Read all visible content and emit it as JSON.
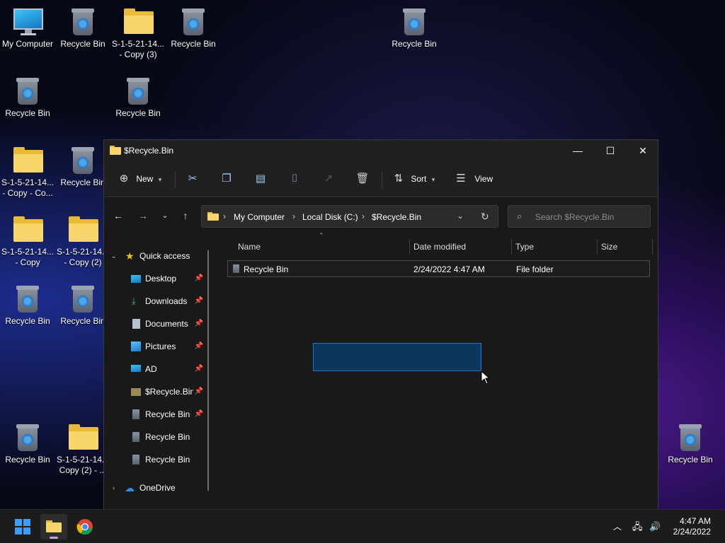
{
  "desktop": {
    "icons": [
      {
        "label": "My Computer",
        "kind": "monitor"
      },
      {
        "label": "Recycle Bin",
        "kind": "bin"
      },
      {
        "label1": "S-1-5-21-14...",
        "label2": "- Copy (3)",
        "kind": "folder"
      },
      {
        "label": "Recycle Bin",
        "kind": "bin"
      },
      {
        "label": "Recycle Bin",
        "kind": "bin"
      },
      {
        "label": "Recycle Bin",
        "kind": "bin"
      },
      {
        "label": "Recycle Bin",
        "kind": "bin"
      },
      {
        "label1": "S-1-5-21-14...",
        "label2": "- Copy - Co...",
        "kind": "folder"
      },
      {
        "label": "Recycle Bin",
        "kind": "bin"
      },
      {
        "label1": "S-1-5-21-14...",
        "label2": "- Copy",
        "kind": "folder"
      },
      {
        "label1": "S-1-5-21-14...",
        "label2": "- Copy (2)",
        "kind": "folder"
      },
      {
        "label": "Recycle Bin",
        "kind": "bin"
      },
      {
        "label": "Recycle Bin",
        "kind": "bin"
      },
      {
        "label": "Recycle Bin",
        "kind": "bin"
      },
      {
        "label1": "S-1-5-21-14...",
        "label2": "Copy (2) - ...",
        "kind": "folder"
      },
      {
        "label": "Recycle Bin",
        "kind": "bin"
      }
    ]
  },
  "window": {
    "title": "$Recycle.Bin",
    "minimize": "—",
    "maximize": "☐",
    "close": "✕"
  },
  "toolbar": {
    "new_label": "New",
    "sort_label": "Sort",
    "view_label": "View"
  },
  "address": {
    "crumbs": [
      "My Computer",
      "Local Disk (C:)",
      "$Recycle.Bin"
    ],
    "search_placeholder": "Search $Recycle.Bin"
  },
  "navpane": {
    "quick_access": "Quick access",
    "items": [
      "Desktop",
      "Downloads",
      "Documents",
      "Pictures",
      "AD",
      "$Recycle.Bin",
      "Recycle Bin",
      "Recycle Bin",
      "Recycle Bin"
    ],
    "onedrive": "OneDrive"
  },
  "columns": {
    "name": "Name",
    "date": "Date modified",
    "type": "Type",
    "size": "Size"
  },
  "files": [
    {
      "name": "Recycle Bin",
      "date": "2/24/2022 4:47 AM",
      "type": "File folder",
      "size": ""
    }
  ],
  "taskbar": {
    "time": "4:47 AM",
    "date": "2/24/2022"
  },
  "colors": {
    "accent": "#0067c0",
    "selection": "#1b78d0",
    "folder": "#f8d66a"
  }
}
